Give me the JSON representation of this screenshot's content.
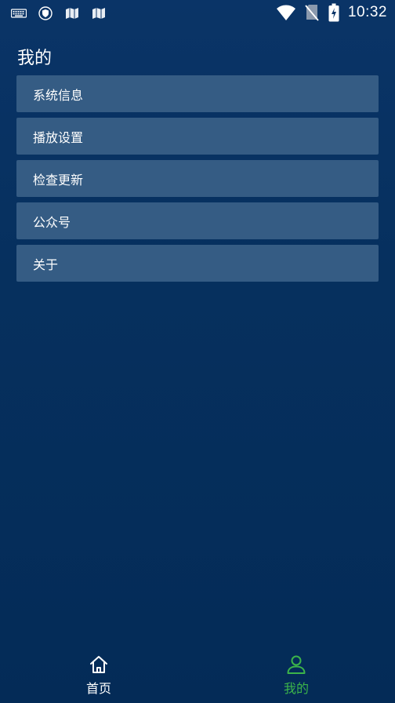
{
  "status_bar": {
    "time": "10:32",
    "left_icons": [
      "keyboard-icon",
      "shield-icon",
      "map-icon",
      "map-icon"
    ],
    "right_icons": [
      "wifi-icon",
      "no-sim-icon",
      "battery-charging-icon"
    ]
  },
  "page": {
    "title": "我的"
  },
  "menu": {
    "items": [
      {
        "label": "系统信息"
      },
      {
        "label": "播放设置"
      },
      {
        "label": "检查更新"
      },
      {
        "label": "公众号"
      },
      {
        "label": "关于"
      }
    ]
  },
  "bottom_nav": {
    "tabs": [
      {
        "label": "首页",
        "icon": "home-icon",
        "active": false
      },
      {
        "label": "我的",
        "icon": "user-icon",
        "active": true
      }
    ],
    "active_color": "#3cb44a"
  },
  "colors": {
    "background": "#06305e",
    "menu_item": "#355c84",
    "accent": "#3cb44a"
  }
}
